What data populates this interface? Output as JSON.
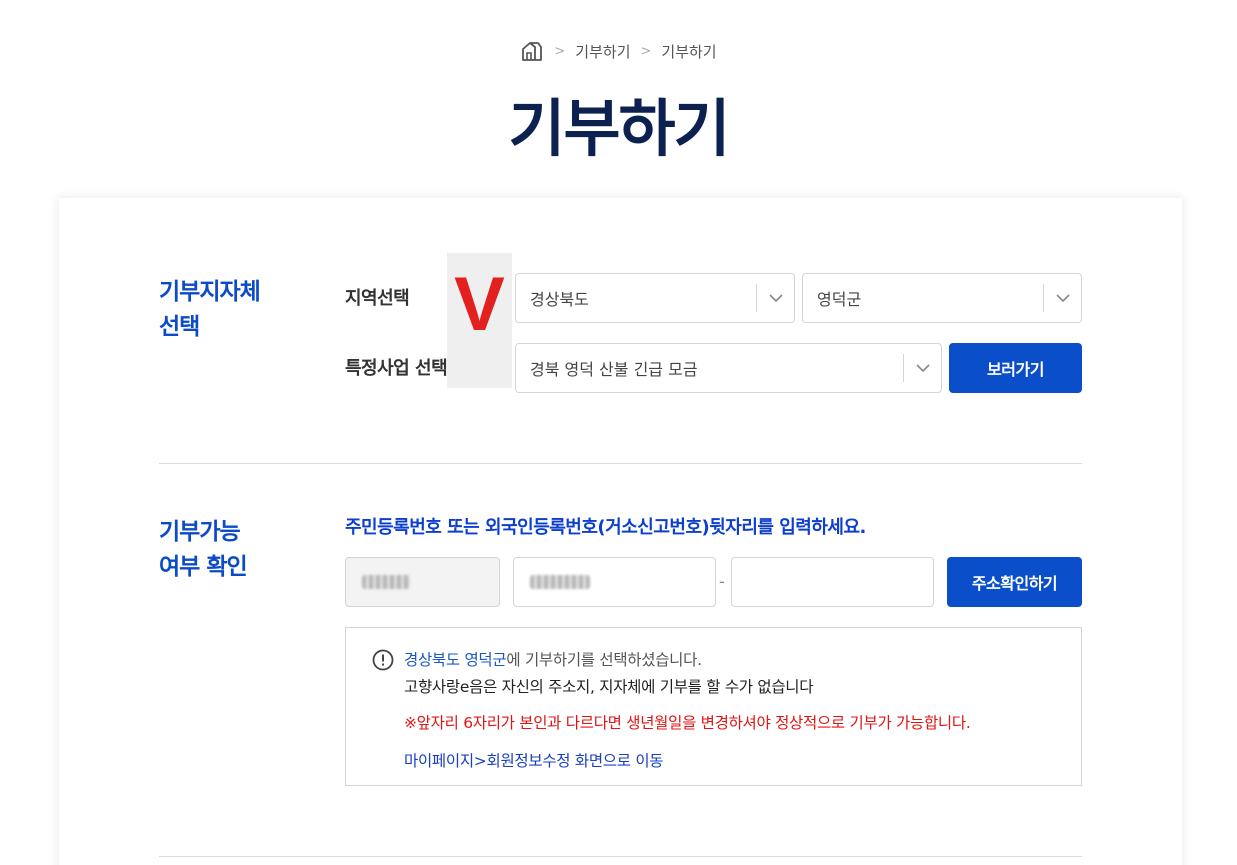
{
  "breadcrumb": {
    "home_icon": "home-icon",
    "items": [
      "기부하기",
      "기부하기"
    ],
    "separator": ">"
  },
  "page_title": "기부하기",
  "colors": {
    "brand": "#0a4fc9",
    "title": "#0d2150",
    "section_title": "#0b4bc7",
    "warning": "#e31414"
  },
  "select_section": {
    "title_line1": "기부지자체",
    "title_line2": "선택",
    "region_label": "지역선택",
    "project_label": "특정사업 선택",
    "province_value": "경상북도",
    "county_value": "영덕군",
    "project_value": "경북 영덕 산불 긴급 모금",
    "view_button": "보러가기",
    "overlay_mark": "V"
  },
  "verify_section": {
    "title_line1": "기부가능",
    "title_line2": "여부 확인",
    "instruction": "주민등록번호 또는 외국인등록번호(거소신고번호)뒷자리를 입력하세요.",
    "dash": "-",
    "back_number_value": "",
    "address_button": "주소확인하기",
    "notice": {
      "icon": "exclamation-circle-icon",
      "line1_highlight": "경상북도 영덕군",
      "line1_rest": "에 기부하기를 선택하셨습니다.",
      "line2": "고향사랑e음은 자신의 주소지, 지자체에 기부를 할 수가 없습니다",
      "line3": "※앞자리 6자리가 본인과 다르다면 생년월일을 변경하셔야 정상적으로 기부가 가능합니다.",
      "line4": "마이페이지>회원정보수정 화면으로 이동"
    }
  }
}
